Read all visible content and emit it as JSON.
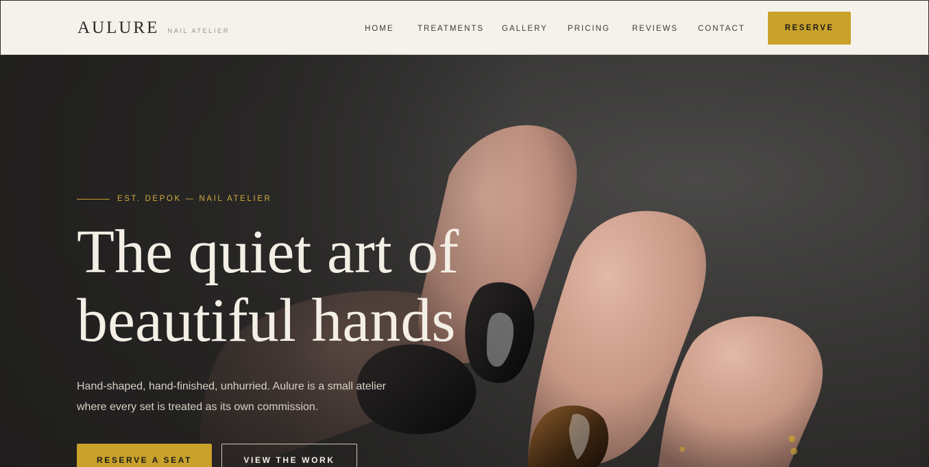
{
  "header": {
    "brand": "AULURE",
    "brand_tagline": "NAIL ATELIER",
    "nav": [
      {
        "label": "HOME"
      },
      {
        "label": "TREATMENTS"
      },
      {
        "label": "GALLERY"
      },
      {
        "label": "PRICING"
      },
      {
        "label": "REVIEWS"
      },
      {
        "label": "CONTACT"
      }
    ],
    "reserve_label": "RESERVE"
  },
  "hero": {
    "eyebrow": "EST. DEPOK — NAIL ATELIER",
    "headline_line1": "The quiet art of",
    "headline_line2": "beautiful hands",
    "lede": "Hand-shaped, hand-finished, unhurried. Aulure is a small atelier where every set is treated as its own commission.",
    "cta_primary": "RESERVE A SEAT",
    "cta_secondary": "VIEW THE WORK",
    "image_subject": "hand-with-black-nails-photo"
  },
  "colors": {
    "header_bg": "#f5f2ec",
    "accent_gold": "#c9a22b",
    "hero_bg": "#2d2c2b",
    "headline": "#f4efe6",
    "body_text": "#d8d1c4"
  }
}
